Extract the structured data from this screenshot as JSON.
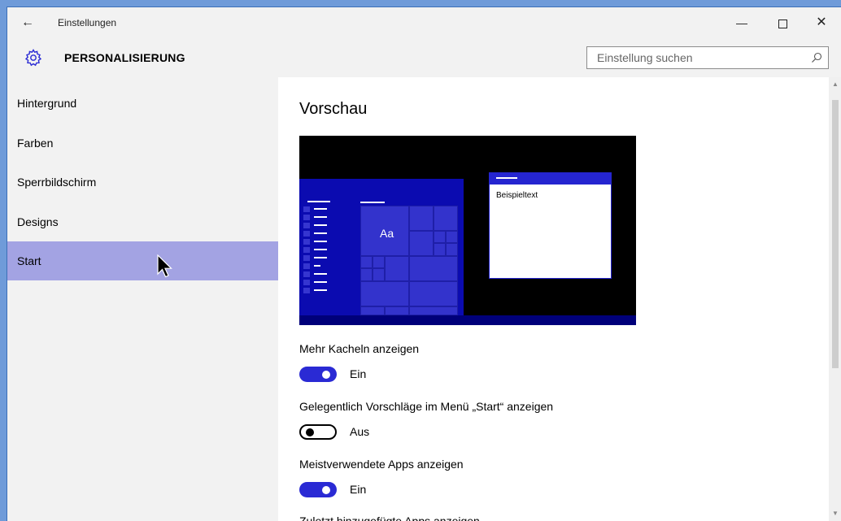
{
  "titlebar": {
    "title": "Einstellungen",
    "back_icon": "arrow-left-icon",
    "minimize_glyph": "—",
    "close_glyph": "✕"
  },
  "header": {
    "title": "PERSONALISIERUNG",
    "icon": "gear-icon",
    "search_placeholder": "Einstellung suchen"
  },
  "colors": {
    "accent": "#2a2ad4",
    "selected_nav": "#a3a3e3",
    "sidebar_bg": "#f2f2f2",
    "desktop_bg": "#6f9bd9"
  },
  "sidebar": {
    "items": [
      {
        "label": "Hintergrund"
      },
      {
        "label": "Farben"
      },
      {
        "label": "Sperrbildschirm"
      },
      {
        "label": "Designs"
      },
      {
        "label": "Start",
        "selected": true
      }
    ]
  },
  "main": {
    "section_title": "Vorschau",
    "preview": {
      "tile_label": "Aa",
      "window_text": "Beispieltext"
    },
    "settings": [
      {
        "label": "Mehr Kacheln anzeigen",
        "on": true,
        "state_label": "Ein"
      },
      {
        "label": "Gelegentlich Vorschläge im Menü „Start“ anzeigen",
        "on": false,
        "state_label": "Aus"
      },
      {
        "label": "Meistverwendete Apps anzeigen",
        "on": true,
        "state_label": "Ein"
      },
      {
        "label": "Zuletzt hinzugefügte Apps anzeigen"
      }
    ]
  }
}
